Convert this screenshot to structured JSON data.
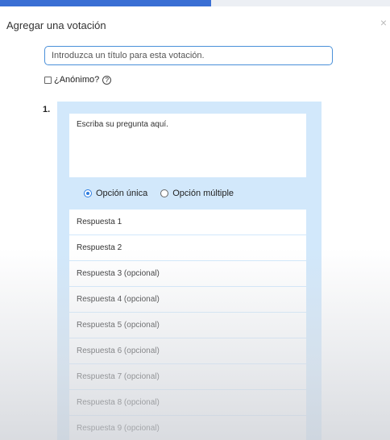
{
  "dialog": {
    "title": "Agregar una votación",
    "close_glyph": "×"
  },
  "poll": {
    "title_placeholder": "Introduzca un título para esta votación.",
    "anonymous_label": "¿Anónimo?",
    "help_glyph": "?"
  },
  "question": {
    "number": "1.",
    "placeholder": "Escriba su pregunta aquí.",
    "options": [
      {
        "label": "Opción única",
        "selected": true
      },
      {
        "label": "Opción múltiple",
        "selected": false
      }
    ],
    "answers": [
      "Respuesta 1",
      "Respuesta 2",
      "Respuesta 3 (opcional)",
      "Respuesta 4 (opcional)",
      "Respuesta 5 (opcional)",
      "Respuesta 6 (opcional)",
      "Respuesta 7 (opcional)",
      "Respuesta 8 (opcional)",
      "Respuesta 9 (opcional)"
    ]
  },
  "colors": {
    "background": "#3a6fd4",
    "panel": "#d2e8fb",
    "accent": "#2d7de0",
    "input_border": "#4a90d9"
  }
}
